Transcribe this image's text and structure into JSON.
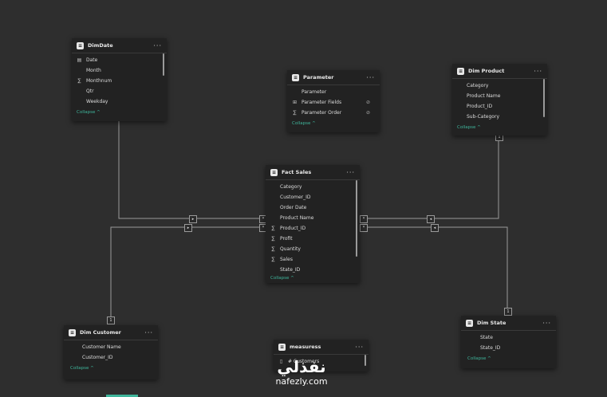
{
  "tables": {
    "dimdate": {
      "title": "DimDate",
      "fields": [
        {
          "icon": "calendar-icon",
          "name": "Date"
        },
        {
          "icon": "",
          "name": "Month"
        },
        {
          "icon": "sigma-icon",
          "name": "Monthnum"
        },
        {
          "icon": "",
          "name": "Qtr"
        },
        {
          "icon": "",
          "name": "Weekday"
        }
      ],
      "collapse": "Collapse ^"
    },
    "parameter": {
      "title": "Parameter",
      "fields": [
        {
          "icon": "",
          "name": "Parameter"
        },
        {
          "icon": "parameter-fields-icon",
          "name": "Parameter Fields",
          "hidden": true
        },
        {
          "icon": "sigma-icon",
          "name": "Parameter Order",
          "hidden": true
        }
      ],
      "collapse": "Collapse ^"
    },
    "dimproduct": {
      "title": "Dim Product",
      "fields": [
        {
          "icon": "",
          "name": "Category"
        },
        {
          "icon": "",
          "name": "Product Name"
        },
        {
          "icon": "",
          "name": "Product_ID"
        },
        {
          "icon": "",
          "name": "Sub-Category"
        }
      ],
      "collapse": "Collapse ^"
    },
    "factsales": {
      "title": "Fact Sales",
      "fields": [
        {
          "icon": "",
          "name": "Category"
        },
        {
          "icon": "",
          "name": "Customer_ID"
        },
        {
          "icon": "",
          "name": "Order Date"
        },
        {
          "icon": "",
          "name": "Product Name"
        },
        {
          "icon": "sigma-icon",
          "name": "Product_ID"
        },
        {
          "icon": "sigma-icon",
          "name": "Profit"
        },
        {
          "icon": "sigma-icon",
          "name": "Quantity"
        },
        {
          "icon": "sigma-icon",
          "name": "Sales"
        },
        {
          "icon": "",
          "name": "State_ID"
        }
      ],
      "collapse": "Collapse ^"
    },
    "dimcustomer": {
      "title": "Dim Customer",
      "fields": [
        {
          "icon": "",
          "name": "Customer Name"
        },
        {
          "icon": "",
          "name": "Customer_ID"
        }
      ],
      "collapse": "Collapse ^"
    },
    "measuress": {
      "title": "measuress",
      "fields": [
        {
          "icon": "measure-icon",
          "name": "# Customers"
        }
      ],
      "collapse": ""
    },
    "dimstate": {
      "title": "Dim State",
      "fields": [
        {
          "icon": "",
          "name": "State"
        },
        {
          "icon": "",
          "name": "State_ID"
        }
      ],
      "collapse": "Collapse ^"
    }
  },
  "relationships": {
    "one": "1",
    "many": "*"
  },
  "icons": {
    "table": "table-icon",
    "more": "more-options-icon",
    "filter_direction": "filter-direction-icon",
    "hidden": "hidden-eye-icon"
  },
  "colors": {
    "canvas": "#2e2e2e",
    "card": "#222222",
    "accent": "#3fb59b",
    "line": "#9a9a9a"
  },
  "watermark": {
    "arabic": "نفذلي",
    "site": "nafezly.com"
  }
}
